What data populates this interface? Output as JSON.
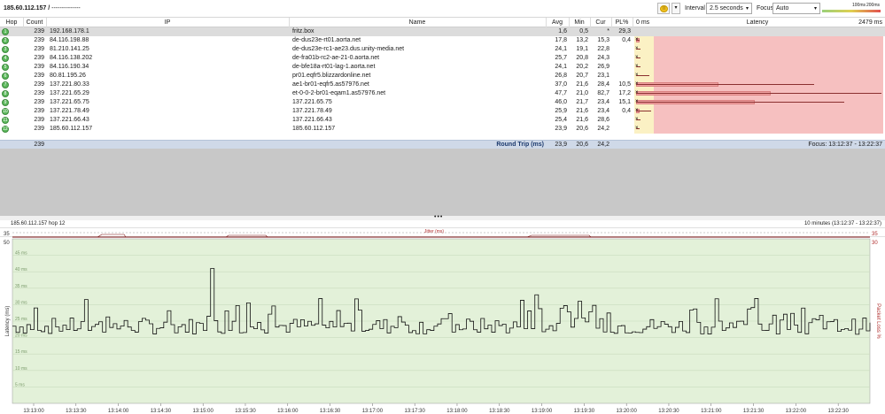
{
  "toolbar": {
    "target": "185.60.112.157 /",
    "target_suffix": "--------------",
    "interval_label": "Interval",
    "interval_value": "2.5 seconds",
    "focus_label": "Focus",
    "focus_value": "Auto",
    "legend_100": "100ms",
    "legend_200": "200ms",
    "pause_icon": "pause-icon"
  },
  "columns": {
    "hop": "Hop",
    "count": "Count",
    "ip": "IP",
    "name": "Name",
    "avg": "Avg",
    "min": "Min",
    "cur": "Cur",
    "pl": "PL%",
    "latency": "Latency",
    "lat_min": "0 ms",
    "lat_max": "2479 ms"
  },
  "hops": [
    {
      "hop": "1",
      "count": "239",
      "ip": "192.168.178.1",
      "name": "fritz.box",
      "avg": "1,6",
      "min": "0,5",
      "cur": "*",
      "pl": "29,3",
      "plf": 0.293,
      "avgv": 1.6,
      "minv": 0.5,
      "maxv": 2479
    },
    {
      "hop": "2",
      "count": "239",
      "ip": "84.116.198.88",
      "name": "de-dus23e-rt01.aorta.net",
      "avg": "17,8",
      "min": "13,2",
      "cur": "15,3",
      "pl": "0,4",
      "plf": 0.004,
      "avgv": 17.8,
      "minv": 13.2,
      "maxv": 40
    },
    {
      "hop": "3",
      "count": "239",
      "ip": "81.210.141.25",
      "name": "de-dus23e-rc1-ae23.dus.unity-media.net",
      "avg": "24,1",
      "min": "19,1",
      "cur": "22,8",
      "pl": "",
      "plf": 0,
      "avgv": 24.1,
      "minv": 19.1,
      "maxv": 45
    },
    {
      "hop": "4",
      "count": "239",
      "ip": "84.116.138.202",
      "name": "de-fra01b-rc2-ae-21-0.aorta.net",
      "avg": "25,7",
      "min": "20,8",
      "cur": "24,3",
      "pl": "",
      "plf": 0,
      "avgv": 25.7,
      "minv": 20.8,
      "maxv": 48
    },
    {
      "hop": "5",
      "count": "239",
      "ip": "84.116.190.34",
      "name": "de-bfe18a-rt01-lag-1.aorta.net",
      "avg": "24,1",
      "min": "20,2",
      "cur": "26,9",
      "pl": "",
      "plf": 0,
      "avgv": 24.1,
      "minv": 20.2,
      "maxv": 45
    },
    {
      "hop": "6",
      "count": "239",
      "ip": "80.81.195.26",
      "name": "pr01.eqfr5.blizzardonline.net",
      "avg": "26,8",
      "min": "20,7",
      "cur": "23,1",
      "pl": "",
      "plf": 0,
      "avgv": 26.8,
      "minv": 20.7,
      "maxv": 130
    },
    {
      "hop": "7",
      "count": "239",
      "ip": "137.221.80.33",
      "name": "ae1-br01-eqfr5.as57976.net",
      "avg": "37,0",
      "min": "21,6",
      "cur": "28,4",
      "pl": "10,5",
      "plf": 0.105,
      "avgv": 37.0,
      "minv": 21.6,
      "maxv": 1800
    },
    {
      "hop": "8",
      "count": "239",
      "ip": "137.221.65.29",
      "name": "et-0-0-2-br01-eqam1.as57976.net",
      "avg": "47,7",
      "min": "21,0",
      "cur": "82,7",
      "pl": "17,2",
      "plf": 0.172,
      "avgv": 47.7,
      "minv": 21.0,
      "maxv": 2479
    },
    {
      "hop": "9",
      "count": "239",
      "ip": "137.221.65.75",
      "name": "137.221.65.75",
      "avg": "46,0",
      "min": "21,7",
      "cur": "23,4",
      "pl": "15,1",
      "plf": 0.151,
      "avgv": 46.0,
      "minv": 21.7,
      "maxv": 2100
    },
    {
      "hop": "10",
      "count": "239",
      "ip": "137.221.78.49",
      "name": "137.221.78.49",
      "avg": "25,9",
      "min": "21,6",
      "cur": "23,4",
      "pl": "0,4",
      "plf": 0.004,
      "avgv": 25.9,
      "minv": 21.6,
      "maxv": 150
    },
    {
      "hop": "11",
      "count": "239",
      "ip": "137.221.66.43",
      "name": "137.221.66.43",
      "avg": "25,4",
      "min": "21,6",
      "cur": "28,6",
      "pl": "",
      "plf": 0,
      "avgv": 25.4,
      "minv": 21.6,
      "maxv": 45
    },
    {
      "hop": "12",
      "count": "239",
      "ip": "185.60.112.157",
      "name": "185.60.112.157",
      "avg": "23,9",
      "min": "20,6",
      "cur": "24,2",
      "pl": "",
      "plf": 0,
      "avgv": 23.9,
      "minv": 20.6,
      "maxv": 40
    }
  ],
  "summary": {
    "count": "239",
    "label": "Round Trip (ms)",
    "avg": "23,9",
    "min": "20,6",
    "cur": "24,2",
    "focus": "Focus: 13:12:37 - 13:22:37"
  },
  "graph": {
    "title": "185.60.112.157 hop 12",
    "range": "10 minutes (13:12:37 - 13:22:37)",
    "jitter_label": "Jitter (ms)",
    "ylabel": "Latency (ms)",
    "y2label": "Packet Loss %",
    "y_top": "50",
    "y_jitter": "35",
    "y2_top": "30",
    "y2_jitter": "35",
    "ymax": 50,
    "y_ticks": [
      "45 ms",
      "40 ms",
      "35 ms",
      "30 ms",
      "25 ms",
      "20 ms",
      "15 ms",
      "10 ms",
      "5 ms"
    ],
    "x_ticks": [
      "13:13:00",
      "13:13:30",
      "13:14:00",
      "13:14:30",
      "13:15:00",
      "13:15:30",
      "13:16:00",
      "13:16:30",
      "13:17:00",
      "13:17:30",
      "13:18:00",
      "13:18:30",
      "13:19:00",
      "13:19:30",
      "13:20:00",
      "13:20:30",
      "13:21:00",
      "13:21:30",
      "13:22:00",
      "13:22:30"
    ]
  },
  "colors": {
    "graph_bg": "#e3f1d9",
    "latency_red": "#f6c0c0",
    "latency_yellow": "#fbf1c4",
    "summary_bg": "#cfd9e8",
    "hop_green": "#5cb85c"
  }
}
